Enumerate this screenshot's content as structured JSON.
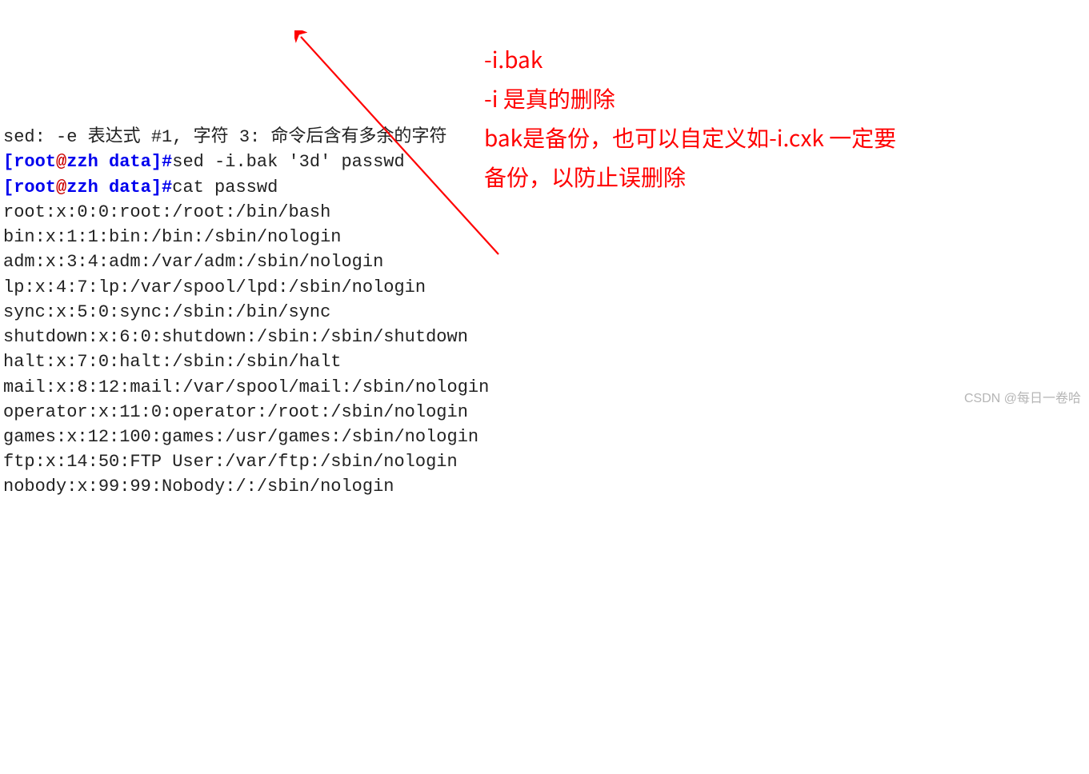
{
  "cutoff_top": "sed: -e 表达式 #1, 字符 3: 命令后含有多余的字符",
  "prompt": {
    "open": "[",
    "user": "root",
    "at": "@",
    "host": "zzh",
    "space": " ",
    "dir": "data",
    "close": "]",
    "hash": "#"
  },
  "cmd1": "sed -i.bak '3d' passwd",
  "cmd2": "cat passwd",
  "output": [
    "root:x:0:0:root:/root:/bin/bash",
    "bin:x:1:1:bin:/bin:/sbin/nologin",
    "adm:x:3:4:adm:/var/adm:/sbin/nologin",
    "lp:x:4:7:lp:/var/spool/lpd:/sbin/nologin",
    "sync:x:5:0:sync:/sbin:/bin/sync",
    "shutdown:x:6:0:shutdown:/sbin:/sbin/shutdown",
    "halt:x:7:0:halt:/sbin:/sbin/halt",
    "mail:x:8:12:mail:/var/spool/mail:/sbin/nologin",
    "operator:x:11:0:operator:/root:/sbin/nologin",
    "games:x:12:100:games:/usr/games:/sbin/nologin",
    "ftp:x:14:50:FTP User:/var/ftp:/sbin/nologin",
    "nobody:x:99:99:Nobody:/:/sbin/nologin"
  ],
  "annotation": {
    "l1": "-i.bak",
    "l2": "-i 是真的删除",
    "l3": "bak是备份，也可以自定义如-i.cxk  一定要备份，以防止误删除"
  },
  "watermark": "CSDN @每日一卷哈"
}
